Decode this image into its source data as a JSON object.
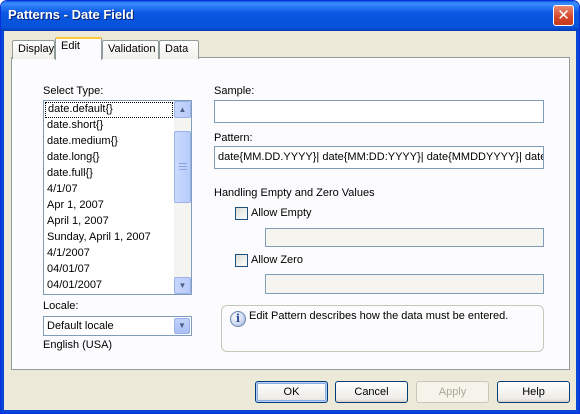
{
  "window": {
    "title": "Patterns - Date Field"
  },
  "tabs": [
    {
      "label": "Display",
      "active": false
    },
    {
      "label": "Edit",
      "active": true
    },
    {
      "label": "Validation",
      "active": false
    },
    {
      "label": "Data",
      "active": false
    }
  ],
  "select_type": {
    "label": "Select Type:",
    "items": [
      "date.default{}",
      "date.short{}",
      "date.medium{}",
      "date.long{}",
      "date.full{}",
      "4/1/07",
      "Apr 1, 2007",
      "April 1, 2007",
      "Sunday, April 1, 2007",
      "4/1/2007",
      "04/01/07",
      "04/01/2007"
    ],
    "selected_index": 0
  },
  "locale": {
    "label": "Locale:",
    "value": "Default locale",
    "description": "English (USA)"
  },
  "sample": {
    "label": "Sample:",
    "value": ""
  },
  "pattern": {
    "label": "Pattern:",
    "value": "date{MM.DD.YYYY}| date{MM:DD:YYYY}| date{MMDDYYYY}| date{"
  },
  "empty_zero": {
    "heading": "Handling Empty and Zero Values",
    "allow_empty_label": "Allow Empty",
    "allow_empty_checked": false,
    "allow_empty_value": "",
    "allow_zero_label": "Allow Zero",
    "allow_zero_checked": false,
    "allow_zero_value": ""
  },
  "info": {
    "text": "Edit Pattern describes how the data must be entered."
  },
  "buttons": {
    "ok": "OK",
    "cancel": "Cancel",
    "apply": "Apply",
    "help": "Help"
  },
  "icons": {
    "close": "close-icon",
    "info": "info-icon",
    "up": "scroll-up-icon",
    "down": "scroll-down-icon",
    "dropdown": "chevron-down-icon"
  },
  "colors": {
    "titlebar": "#0a57e2",
    "dialog": "#ece9d8",
    "active_tab": "#ffc83c"
  }
}
